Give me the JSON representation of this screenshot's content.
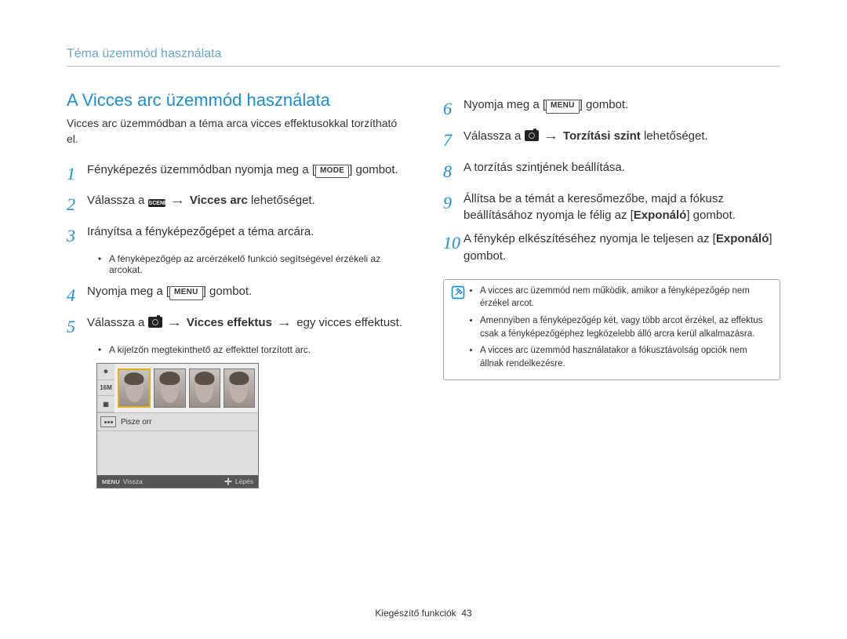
{
  "header": {
    "breadcrumb": "Téma üzemmód használata"
  },
  "section": {
    "title": "A Vicces arc üzemmód használata",
    "intro": "Vicces arc üzemmódban a téma arca vicces effektusokkal torzítható el."
  },
  "buttons": {
    "mode": "MODE",
    "menu": "MENU"
  },
  "icons": {
    "scene_label": "SCENE"
  },
  "left_steps": {
    "s1": {
      "n": "1",
      "before": "Fényképezés üzemmódban nyomja meg a [",
      "after": "] gombot."
    },
    "s2": {
      "n": "2",
      "before": "Válassza a ",
      "bold": "Vicces arc",
      "after": " lehetőséget."
    },
    "s3": {
      "n": "3",
      "text": "Irányítsa a fényképezőgépet a téma arcára.",
      "sub": "A fényképezőgép az arcérzékelő funkció segítségével érzékeli az arcokat."
    },
    "s4": {
      "n": "4",
      "before": "Nyomja meg a [",
      "after": "] gombot."
    },
    "s5": {
      "n": "5",
      "before": "Válassza a ",
      "bold": "Vicces effektus",
      "after_arrow": "egy vicces effektust.",
      "sub": "A kijelzőn megtekinthető az effekttel torzított arc."
    }
  },
  "lcd": {
    "caption": "Pisze orr",
    "foot_left_btn": "MENU",
    "foot_left_label": "Vissza",
    "foot_right_label": "Lépés"
  },
  "right_steps": {
    "s6": {
      "n": "6",
      "before": "Nyomja meg a [",
      "after": "] gombot."
    },
    "s7": {
      "n": "7",
      "before": "Válassza a ",
      "bold": "Torzítási szint",
      "after": " lehetőséget."
    },
    "s8": {
      "n": "8",
      "text": "A torzítás szintjének beállítása."
    },
    "s9": {
      "n": "9",
      "text_a": "Állítsa be a témát a keresőmezőbe, majd a fókusz beállításához nyomja le félig az [",
      "bold": "Exponáló",
      "text_b": "] gombot."
    },
    "s10": {
      "n": "10",
      "text_a": "A fénykép elkészítéséhez nyomja le teljesen az [",
      "bold": "Exponáló",
      "text_b": "] gombot."
    }
  },
  "notes": {
    "n1": "A vicces arc üzemmód nem működik, amikor a fényképezőgép nem érzékel arcot.",
    "n2": "Amennyiben a fényképezőgép két, vagy több arcot érzékel, az effektus csak a fényképezőgéphez legközelebb álló arcra kerül alkalmazásra.",
    "n3": "A vicces arc üzemmód használatakor a fókusztávolság opciók nem állnak rendelkezésre."
  },
  "footer": {
    "section": "Kiegészítő funkciók",
    "page": "43"
  },
  "arrow": "→"
}
